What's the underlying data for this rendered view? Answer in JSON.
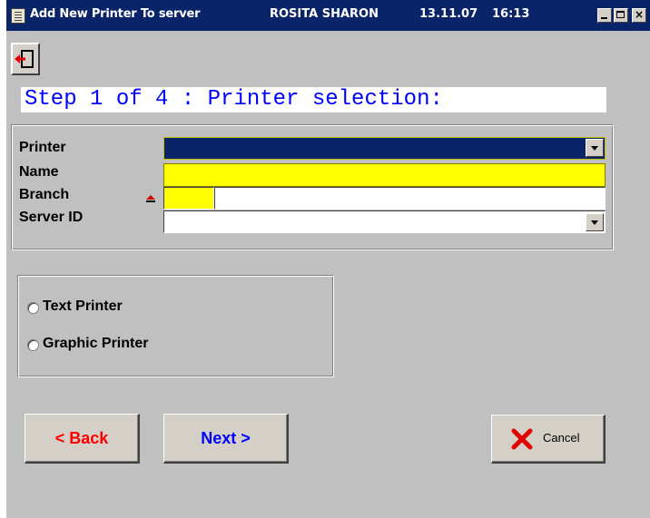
{
  "window": {
    "title": "Add New Printer To server",
    "user": "ROSITA SHARON",
    "date": "13.11.07",
    "time": "16:13",
    "controls": {
      "minimize_icon": "minimize-icon",
      "maximize_icon": "maximize-icon",
      "close_label": "×"
    }
  },
  "toolbar": {
    "exit_icon": "exit-door-icon"
  },
  "step": {
    "text": "Step 1 of 4 : Printer selection:",
    "color": "#0000ff"
  },
  "form": {
    "printer": {
      "label": "Printer",
      "value": "",
      "field_color": "#0a246a"
    },
    "name": {
      "label": "Name",
      "value": "",
      "field_color": "#ffff00"
    },
    "branch": {
      "label": "Branch",
      "required_icon": "required-marker-icon",
      "code": "",
      "name": ""
    },
    "server_id": {
      "label": "Server ID",
      "value": ""
    }
  },
  "printer_type": {
    "options": [
      "Text Printer",
      "Graphic Printer"
    ]
  },
  "buttons": {
    "back": {
      "label": "< Back",
      "color": "#ff0000"
    },
    "next": {
      "label": "Next >",
      "color": "#0000ff"
    },
    "cancel": {
      "label": "Cancel",
      "icon": "red-x-icon"
    }
  }
}
